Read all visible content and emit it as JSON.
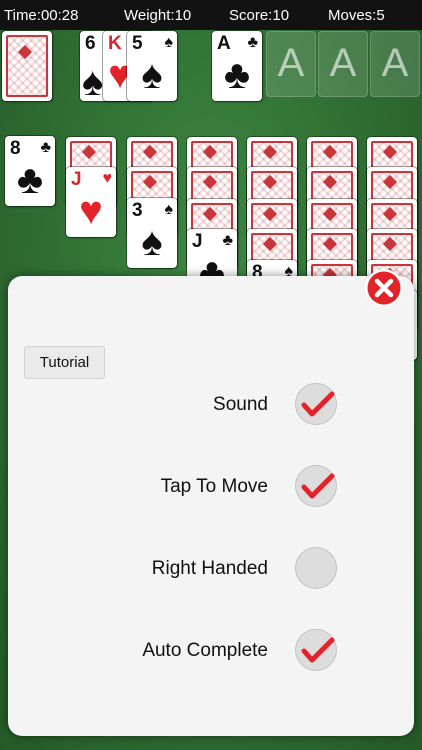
{
  "status": {
    "time": "Time:00:28",
    "weight": "Weight:10",
    "score": "Score:10",
    "moves": "Moves:5"
  },
  "waste": [
    {
      "rank": "6",
      "suit": "♠",
      "color": "#111111"
    },
    {
      "rank": "K",
      "suit": "♥",
      "color": "#e2232a"
    },
    {
      "rank": "5",
      "suit": "♠",
      "color": "#111111"
    }
  ],
  "foundations": [
    {
      "rank": "A",
      "suit": "♣",
      "color": "#111111"
    },
    {
      "placeholder": "A"
    },
    {
      "placeholder": "A"
    },
    {
      "placeholder": "A"
    }
  ],
  "tableau": [
    {
      "column": 1,
      "face_up": [
        {
          "rank": "8",
          "suit": "♣",
          "color": "#111111"
        }
      ]
    },
    {
      "column": 2,
      "face_up": [
        {
          "rank": "J",
          "suit": "♥",
          "color": "#e2232a"
        }
      ]
    },
    {
      "column": 3,
      "face_up": [
        {
          "rank": "3",
          "suit": "♠",
          "color": "#111111"
        }
      ]
    },
    {
      "column": 4,
      "face_up": [
        {
          "rank": "J",
          "suit": "♣",
          "color": "#111111"
        }
      ]
    },
    {
      "column": 5,
      "face_up": [
        {
          "rank": "8",
          "suit": "♠",
          "color": "#111111"
        }
      ]
    }
  ],
  "settings": {
    "tutorial_label": "Tutorial",
    "options": [
      {
        "label": "Sound",
        "checked": true
      },
      {
        "label": "Tap To Move",
        "checked": true
      },
      {
        "label": "Right Handed",
        "checked": false
      },
      {
        "label": "Auto Complete",
        "checked": true
      }
    ]
  },
  "icons": {
    "close": "close-icon",
    "check": "checkmark-icon"
  },
  "colors": {
    "felt": "#2f6e33",
    "card_back": "#c8353a",
    "close_red": "#e2232a",
    "check_red": "#e2232a"
  }
}
